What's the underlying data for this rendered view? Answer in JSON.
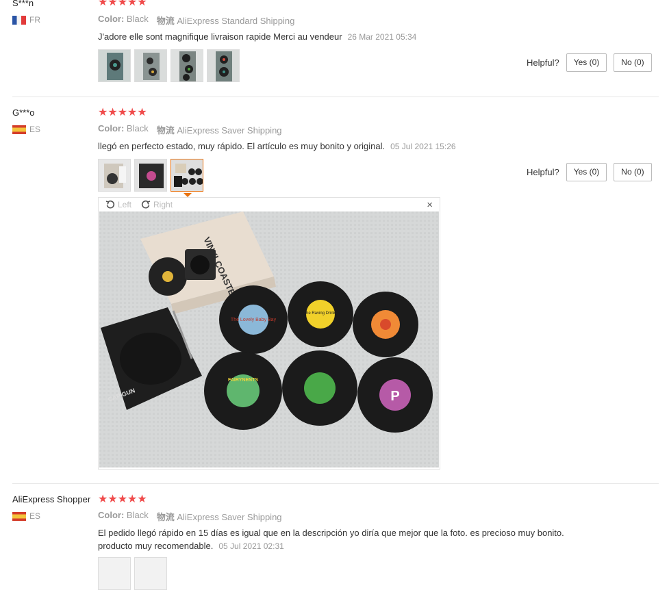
{
  "reviews": [
    {
      "user": "S***n",
      "country": "FR",
      "stars": "★★★★★",
      "color_label": "Color:",
      "color_value": "Black",
      "shipping_icon": "物流",
      "shipping": "AliExpress Standard Shipping",
      "text": "J'adore elle sont magnifique livraison rapide Merci au vendeur",
      "date": "26 Mar 2021 05:34",
      "helpful_label": "Helpful?",
      "yes_label": "Yes (0)",
      "no_label": "No (0)"
    },
    {
      "user": "G***o",
      "country": "ES",
      "stars": "★★★★★",
      "color_label": "Color:",
      "color_value": "Black",
      "shipping_icon": "物流",
      "shipping": "AliExpress Saver Shipping",
      "text": "llegó en perfecto estado, muy rápido. El artículo es muy bonito y original.",
      "date": "05 Jul 2021 15:26",
      "helpful_label": "Helpful?",
      "yes_label": "Yes (0)",
      "no_label": "No (0)"
    },
    {
      "user": "AliExpress Shopper",
      "country": "ES",
      "stars": "★★★★★",
      "color_label": "Color:",
      "color_value": "Black",
      "shipping_icon": "物流",
      "shipping": "AliExpress Saver Shipping",
      "text_line1": "El pedido llegó rápido en 15 días es igual que en la descripción yo diría que mejor que la foto. es precioso muy bonito.",
      "text_line2": "producto muy recomendable.",
      "date": "05 Jul 2021 02:31"
    }
  ],
  "viewer": {
    "rotate_left": "Left",
    "rotate_right": "Right",
    "close": "×"
  },
  "photo": {
    "box_text": "VINYLCOASTERS",
    "brand_text": "CAP GUN",
    "record_labels": [
      "The Lovely Baby Bay",
      "The Raving Drinks",
      "",
      "FAIRYNENTS",
      "",
      "P"
    ]
  }
}
